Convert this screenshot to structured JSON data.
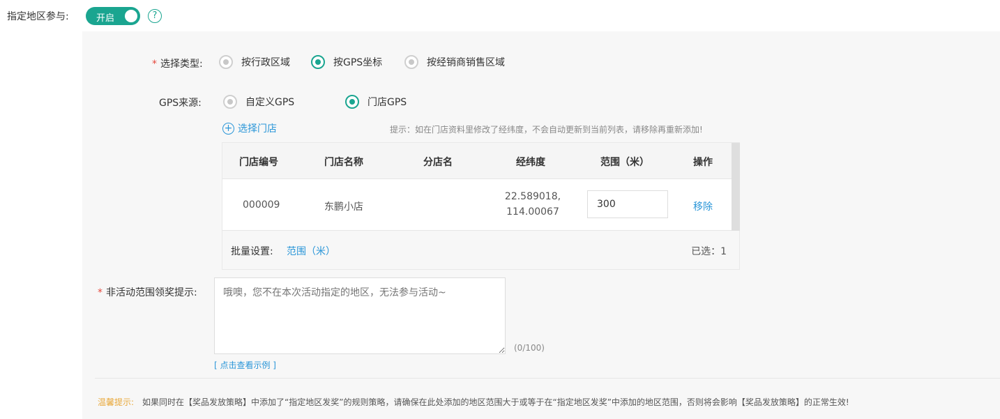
{
  "region": {
    "label": "指定地区参与:",
    "toggle_text": "开启",
    "help_icon": "?"
  },
  "type_select": {
    "required_mark": "*",
    "label": "选择类型:",
    "options": [
      "按行政区域",
      "按GPS坐标",
      "按经销商销售区域"
    ],
    "selected": "按GPS坐标"
  },
  "gps_source": {
    "label": "GPS来源:",
    "options": [
      "自定义GPS",
      "门店GPS"
    ],
    "selected": "门店GPS"
  },
  "store_select": {
    "add_label": "选择门店",
    "plus_icon": "+",
    "hint": "提示：如在门店资料里修改了经纬度，不会自动更新到当前列表，请移除再重新添加!"
  },
  "table": {
    "columns": [
      "门店编号",
      "门店名称",
      "分店名",
      "经纬度",
      "范围（米）",
      "操作"
    ],
    "rows": [
      {
        "code": "000009",
        "name": "东鹏小店",
        "branch": "",
        "lat": "22.589018,",
        "lng": "114.00067",
        "range": "300",
        "action": "移除"
      }
    ],
    "batch_label": "批量设置:",
    "batch_link": "范围（米）",
    "selected_count": "已选：1"
  },
  "prompt": {
    "required_mark": "*",
    "label": "非活动范围领奖提示:",
    "placeholder": "哦噢，您不在本次活动指定的地区，无法参与活动~",
    "counter": "(0/100)",
    "example_link": "[ 点击查看示例 ]"
  },
  "warm_tip": {
    "label": "温馨提示:",
    "text": "如果同时在【奖品发放策略】中添加了“指定地区发奖”的规则策略，请确保在此处添加的地区范围大于或等于在“指定地区发奖”中添加的地区范围，否则将会影响【奖品发放策略】的正常生效!"
  },
  "colors": {
    "accent": "#1aa590",
    "link": "#2a96d8",
    "required": "#e5473b",
    "warm": "#e8a83a"
  }
}
